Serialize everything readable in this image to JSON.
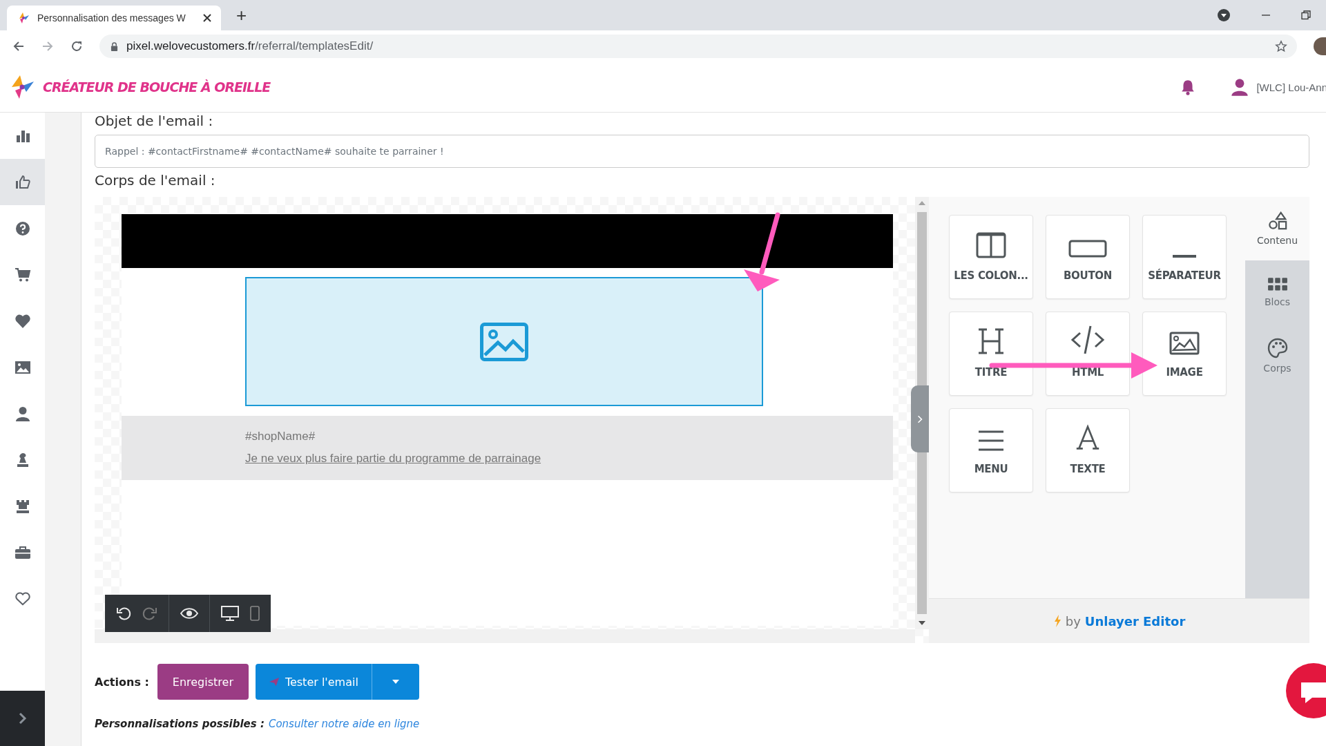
{
  "browser": {
    "tab_title": "Personnalisation des messages W",
    "new_tab": "+",
    "url_host": "pixel.welovecustomers.fr",
    "url_path": "/referral/templatesEdit/"
  },
  "header": {
    "logo": "CRÉATEUR DE BOUCHE À OREILLE",
    "user": "[WLC] Lou-Ann"
  },
  "sidebar": {
    "items": [
      {
        "kind": "chart",
        "selected": false
      },
      {
        "kind": "thumbs-up",
        "selected": true
      },
      {
        "kind": "help",
        "selected": false
      },
      {
        "kind": "cart",
        "selected": false
      },
      {
        "kind": "heart",
        "selected": false
      },
      {
        "kind": "image",
        "selected": false
      },
      {
        "kind": "user",
        "selected": false
      },
      {
        "kind": "chess",
        "selected": false
      },
      {
        "kind": "tower",
        "selected": false
      },
      {
        "kind": "briefcase",
        "selected": false
      },
      {
        "kind": "heart-outline",
        "selected": false
      }
    ]
  },
  "form": {
    "subject_label": "Objet de l'email :",
    "subject_value": "Rappel : #contactFirstname# #contactName# souhaite te parrainer !",
    "body_label": "Corps de l'email :"
  },
  "email": {
    "shop_name": "#shopName#",
    "unsubscribe_link": "Je ne veux plus faire partie du programme de parrainage"
  },
  "tools": [
    {
      "label": "LES COLON...",
      "kind": "columns"
    },
    {
      "label": "BOUTON",
      "kind": "button"
    },
    {
      "label": "SÉPARATEUR",
      "kind": "divider"
    },
    {
      "label": "TITRE",
      "kind": "heading"
    },
    {
      "label": "HTML",
      "kind": "html"
    },
    {
      "label": "IMAGE",
      "kind": "image"
    },
    {
      "label": "MENU",
      "kind": "menu"
    },
    {
      "label": "TEXTE",
      "kind": "text"
    }
  ],
  "panel_tabs": [
    {
      "label": "Contenu",
      "kind": "content",
      "selected": true
    },
    {
      "label": "Blocs",
      "kind": "blocks",
      "selected": false
    },
    {
      "label": "Corps",
      "kind": "body",
      "selected": false
    }
  ],
  "credit": {
    "prefix": "by",
    "brand": "Unlayer Editor"
  },
  "actions": {
    "label": "Actions :",
    "save": "Enregistrer",
    "test": "Tester l'email"
  },
  "help": {
    "label": "Personnalisations possibles :",
    "link": "Consulter notre aide en ligne"
  }
}
